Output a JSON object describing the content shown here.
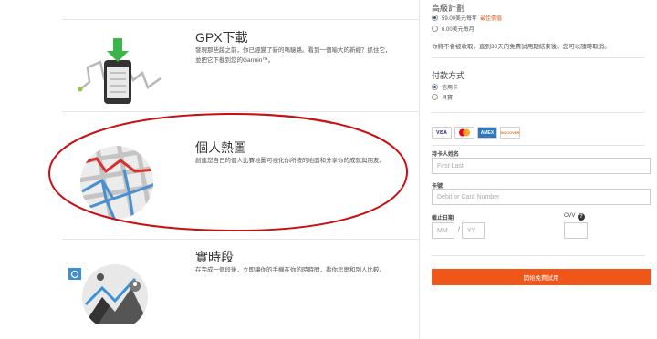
{
  "features": [
    {
      "title": "GPX下載",
      "desc": "發現那些越之前，你已經變了新的嗎驗路。看到一個喻大的新線？抓住它，並把它下載到您的Garmin™。",
      "icon": "gpx-device-icon"
    },
    {
      "title": "個人熱圖",
      "desc": "創建您自己的個人比賽地圖可視化你所按的地面和分享你的成就與朋友。",
      "icon": "heatmap-icon"
    },
    {
      "title": "實時段",
      "desc": "在完成一個段後，立即讓你的手機在你的時時間，看你怎麼和別人比較。",
      "icon": "live-segment-icon"
    }
  ],
  "plan": {
    "title": "高級計劃",
    "options": [
      {
        "label": "59.00美元每年",
        "badge": "最佳價值",
        "checked": true
      },
      {
        "label": "6.00美元每月",
        "badge": "",
        "checked": false
      }
    ],
    "note": "你將不會被收取，直到30天的免費試用期結束後。您可以隨時取消。"
  },
  "payment": {
    "title": "付款方式",
    "options": [
      {
        "label": "信用卡",
        "checked": true
      },
      {
        "label": "貝寶",
        "checked": false
      }
    ],
    "cards": [
      "VISA",
      "MC",
      "AMEX",
      "DISCOVER"
    ]
  },
  "form": {
    "name_label": "持卡人姓名",
    "name_placeholder": "First Last",
    "card_label": "卡號",
    "card_placeholder": "Debit or Card Number",
    "expiry_label": "截止日期",
    "mm_placeholder": "MM",
    "yy_placeholder": "YY",
    "slash": "/",
    "cvv_label": "CVV",
    "help": "?",
    "submit_label": "開始免費試用"
  },
  "colors": {
    "accent": "#f0561a",
    "annotation": "#c80f14",
    "radio": "#1c5aa8"
  }
}
